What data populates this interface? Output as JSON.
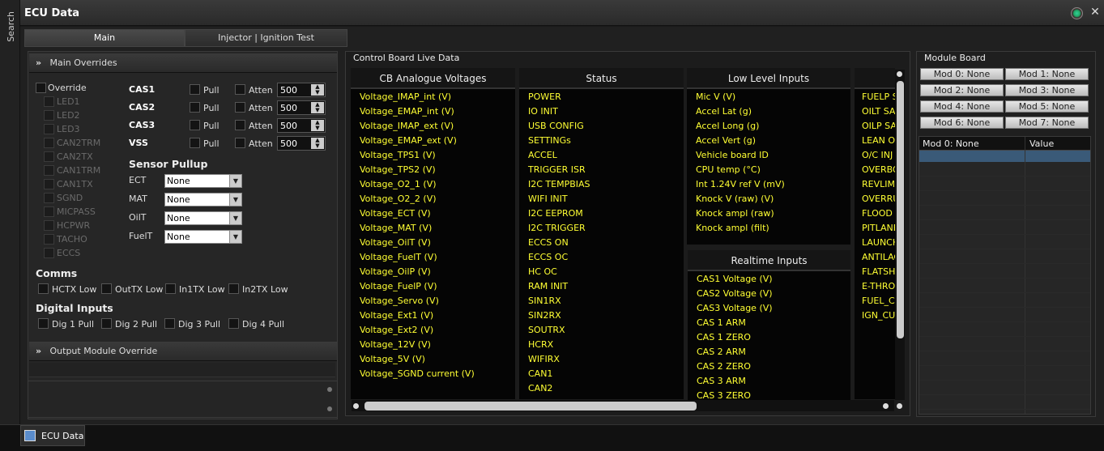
{
  "window": {
    "title": "ECU Data"
  },
  "sidebar": {
    "label": "Search"
  },
  "tabs": [
    {
      "label": "Main"
    },
    {
      "label": "Injector | Ignition Test"
    }
  ],
  "overrides": {
    "header": "Main Overrides",
    "override_label": "Override",
    "items": [
      "LED1",
      "LED2",
      "LED3",
      "CAN2TRM",
      "CAN2TX",
      "CAN1TRM",
      "CAN1TX",
      "SGND",
      "MICPASS",
      "HCPWR",
      "TACHO",
      "ECCS"
    ],
    "cas_rows": [
      {
        "name": "CAS1",
        "pull": "Pull",
        "atten": "Atten",
        "value": "500"
      },
      {
        "name": "CAS2",
        "pull": "Pull",
        "atten": "Atten",
        "value": "500"
      },
      {
        "name": "CAS3",
        "pull": "Pull",
        "atten": "Atten",
        "value": "500"
      },
      {
        "name": "VSS",
        "pull": "Pull",
        "atten": "Atten",
        "value": "500"
      }
    ],
    "sensor_pullup": {
      "title": "Sensor Pullup",
      "rows": [
        {
          "label": "ECT",
          "value": "None"
        },
        {
          "label": "MAT",
          "value": "None"
        },
        {
          "label": "OilT",
          "value": "None"
        },
        {
          "label": "FuelT",
          "value": "None"
        }
      ]
    },
    "comms": {
      "title": "Comms",
      "items": [
        "HCTX Low",
        "OutTX Low",
        "In1TX Low",
        "In2TX Low"
      ]
    },
    "digital_inputs": {
      "title": "Digital Inputs",
      "items": [
        "Dig 1 Pull",
        "Dig 2 Pull",
        "Dig 3 Pull",
        "Dig 4 Pull"
      ]
    },
    "output_module": "Output Module Override"
  },
  "live": {
    "title": "Control Board Live Data",
    "columns": [
      {
        "header": "CB Analogue Voltages",
        "rows": [
          "Voltage_IMAP_int (V)",
          "Voltage_EMAP_int (V)",
          "Voltage_IMAP_ext (V)",
          "Voltage_EMAP_ext (V)",
          "Voltage_TPS1 (V)",
          "Voltage_TPS2 (V)",
          "Voltage_O2_1 (V)",
          "Voltage_O2_2 (V)",
          "Voltage_ECT (V)",
          "Voltage_MAT (V)",
          "Voltage_OilT (V)",
          "Voltage_FuelT (V)",
          "Voltage_OilP (V)",
          "Voltage_FuelP (V)",
          "Voltage_Servo (V)",
          "Voltage_Ext1 (V)",
          "Voltage_Ext2 (V)",
          "Voltage_12V (V)",
          "Voltage_5V (V)",
          "Voltage_SGND current (V)"
        ]
      },
      {
        "header": "Status",
        "rows": [
          "POWER",
          "IO INIT",
          "USB CONFIG",
          "SETTINGs",
          "ACCEL",
          "TRIGGER ISR",
          "I2C TEMPBIAS",
          "WIFI INIT",
          "I2C EEPROM",
          "I2C TRIGGER",
          "ECCS ON",
          "ECCS OC",
          "HC OC",
          "RAM INIT",
          "SIN1RX",
          "SIN2RX",
          "SOUTRX",
          "HCRX",
          "WIFIRX",
          "CAN1",
          "CAN2"
        ]
      },
      {
        "header": "Low Level Inputs",
        "rows": [
          "Mic V (V)",
          "Accel Lat (g)",
          "Accel Long (g)",
          "Accel Vert (g)",
          "Vehicle board ID",
          "CPU temp (°C)",
          "Int 1.24V ref V (mV)",
          "Knock V (raw) (V)",
          "Knock ampl (raw)",
          "Knock ampl (filt)"
        ]
      },
      {
        "header": "Realtime Inputs",
        "rows": [
          "CAS1 Voltage (V)",
          "CAS2 Voltage (V)",
          "CAS3 Voltage (V)",
          "CAS 1 ARM",
          "CAS 1 ZERO",
          "CAS 2 ARM",
          "CAS 2 ZERO",
          "CAS 3 ARM",
          "CAS 3 ZERO"
        ]
      },
      {
        "header": "",
        "rows": [
          "FUELP SA",
          "OILT SA",
          "OILP SA",
          "LEAN OU",
          "O/C INJ",
          "OVERBO",
          "REVLIMI",
          "OVERRU",
          "FLOOD C",
          "PITLANE",
          "LAUNCH",
          "ANTILAG",
          "FLATSH",
          "E-THROT",
          "FUEL_CU",
          "IGN_CUT"
        ]
      }
    ]
  },
  "module_board": {
    "title": "Module Board",
    "buttons": [
      "Mod 0: None",
      "Mod 1: None",
      "Mod 2: None",
      "Mod 3: None",
      "Mod 4: None",
      "Mod 5: None",
      "Mod 6: None",
      "Mod 7: None"
    ],
    "grid_headers": [
      "Mod 0: None",
      "Value"
    ]
  },
  "taskbar": {
    "item": "ECU Data"
  }
}
